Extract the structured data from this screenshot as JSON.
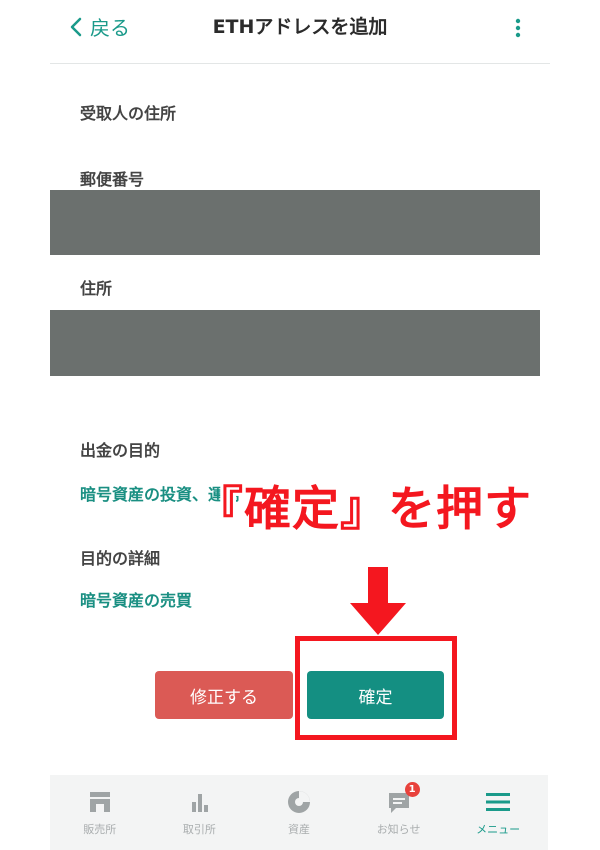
{
  "header": {
    "back_label": "戻る",
    "title": "ETHアドレスを追加"
  },
  "form": {
    "recipient_address_label": "受取人の住所",
    "postal_code_label": "郵便番号",
    "address_label": "住所",
    "purpose_label": "出金の目的",
    "purpose_value": "暗号資産の投資、運用",
    "purpose_detail_label": "目的の詳細",
    "purpose_detail_value": "暗号資産の売買"
  },
  "annotation": {
    "text": "『確定』を押す"
  },
  "buttons": {
    "edit_label": "修正する",
    "confirm_label": "確定"
  },
  "tabbar": {
    "items": [
      {
        "label": "販売所",
        "icon": "shop-icon"
      },
      {
        "label": "取引所",
        "icon": "bar-chart-icon"
      },
      {
        "label": "資産",
        "icon": "pie-chart-icon"
      },
      {
        "label": "お知らせ",
        "icon": "message-icon",
        "badge": "1"
      },
      {
        "label": "メニュー",
        "icon": "menu-icon"
      }
    ]
  },
  "colors": {
    "accent": "#1a9a8a",
    "confirm_button": "#148f82",
    "edit_button": "#db5a55",
    "annotation_red": "#f4171f",
    "masked_field": "#6b706e"
  }
}
